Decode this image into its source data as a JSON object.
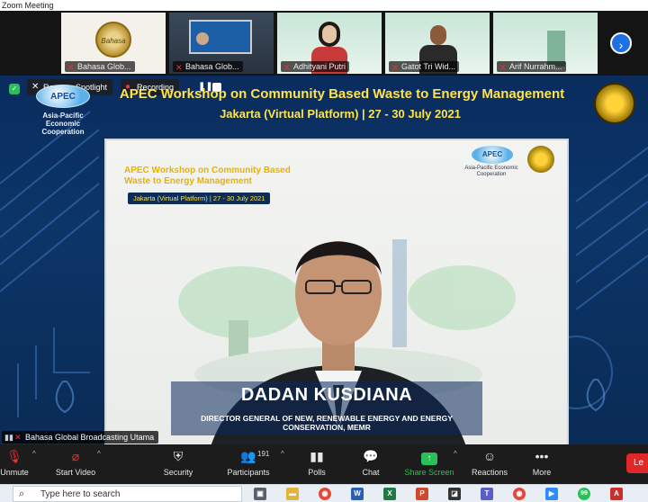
{
  "window": {
    "title": "Zoom Meeting"
  },
  "thumbnails": [
    {
      "name": "Bahasa Glob...",
      "muted": true
    },
    {
      "name": "Bahasa Glob...",
      "muted": true
    },
    {
      "name": "Adhityani Putri",
      "muted": true
    },
    {
      "name": "Gatot Tri Wid...",
      "muted": true
    },
    {
      "name": "Arif Nurrahm...",
      "muted": true
    }
  ],
  "thumbnail_logo_text": "Bahasa",
  "overlay": {
    "remove_spotlight": "Remove Spotlight",
    "recording": "Recording"
  },
  "stage": {
    "title": "APEC Workshop on Community Based Waste to Energy Management",
    "subtitle": "Jakarta (Virtual Platform) | 27 - 30 July 2021",
    "apec_logo_text": "APEC",
    "apec_caption": "Asia-Pacific Economic Cooperation"
  },
  "slide": {
    "title_line1": "APEC Workshop on Community Based",
    "title_line2": "Waste to Energy Management",
    "subtitle": "Jakarta (Virtual Platform) | 27 - 30 July 2021",
    "apec_logo_text": "APEC",
    "apec_caption": "Asia-Pacific Economic Cooperation"
  },
  "speaker": {
    "name": "DADAN KUSDIANA",
    "role": "DIRECTOR GENERAL OF NEW, RENEWABLE ENERGY AND ENERGY CONSERVATION, MEMR"
  },
  "self_view_name": "Bahasa Global Broadcasting Utama",
  "toolbar": {
    "unmute": "Unmute",
    "start_video": "Start Video",
    "security": "Security",
    "participants": "Participants",
    "participants_count": "191",
    "polls": "Polls",
    "chat": "Chat",
    "share_screen": "Share Screen",
    "reactions": "Reactions",
    "more": "More",
    "leave": "Le"
  },
  "taskbar": {
    "search_placeholder": "Type here to search",
    "badge_count": "99"
  },
  "colors": {
    "accent_yellow": "#ffe34a",
    "stage_blue": "#0c3568",
    "share_green": "#2bbf5a",
    "leave_red": "#e02828",
    "zoom_blue": "#1f6fe5"
  }
}
